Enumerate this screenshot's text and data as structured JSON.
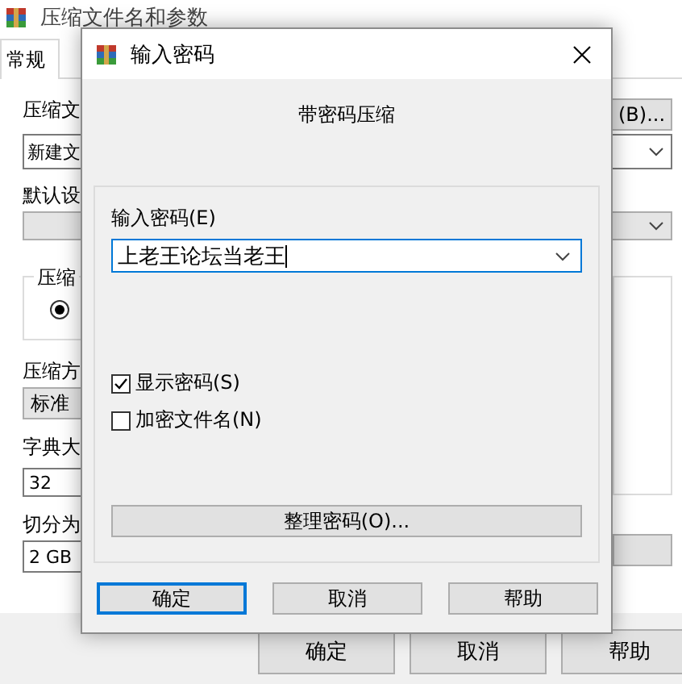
{
  "background_window": {
    "title": "压缩文件名和参数",
    "tabs": [
      {
        "label": "常规",
        "selected": true
      }
    ],
    "archive_name_label": "压缩文",
    "browse_button": "(B)...",
    "archive_name": "新建文",
    "profile_label": "默认设",
    "format_group_label": "压缩",
    "format_radio": {
      "selected": true
    },
    "method_label": "压缩方",
    "method": "标准",
    "dictionary_label": "字典大",
    "dictionary": "32",
    "split_label": "切分为",
    "split": "2 GB",
    "buttons": [
      "确定",
      "取消",
      "帮助"
    ]
  },
  "dialog": {
    "title": "输入密码",
    "heading": "带密码压缩",
    "password_label": "输入密码(E)",
    "password": "上老王论坛当老王",
    "options": [
      {
        "label": "显示密码(S)",
        "checked": true
      },
      {
        "label": "加密文件名(N)",
        "checked": false
      }
    ],
    "organize_button": "整理密码(O)...",
    "buttons": [
      {
        "label": "确定",
        "default": true
      },
      {
        "label": "取消",
        "default": false
      },
      {
        "label": "帮助",
        "default": false
      }
    ]
  }
}
